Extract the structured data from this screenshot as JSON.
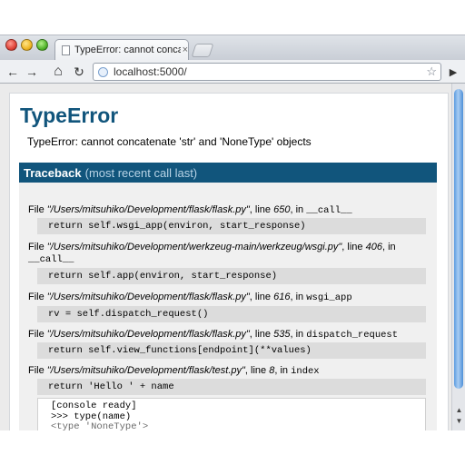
{
  "tab": {
    "title": "TypeError: cannot concatenate",
    "close": "×"
  },
  "toolbar": {
    "back_icon": "←",
    "forward_icon": "→",
    "home_icon": "⌂",
    "reload_icon": "↻",
    "url": "localhost:5000/",
    "star_icon": "☆",
    "page_menu_icon": "▶"
  },
  "error": {
    "title": "TypeError",
    "message": "TypeError: cannot concatenate 'str' and 'NoneType' objects"
  },
  "traceback": {
    "header": "Traceback",
    "header_sub": "(most recent call last)",
    "frames": [
      {
        "file": "\"/Users/mitsuhiko/Development/flask/flask.py\"",
        "line": "650",
        "func": "__call__",
        "code": "return self.wsgi_app(environ, start_response)"
      },
      {
        "file": "\"/Users/mitsuhiko/Development/werkzeug-main/werkzeug/wsgi.py\"",
        "line": "406",
        "func": "__call__",
        "code": "return self.app(environ, start_response)"
      },
      {
        "file": "\"/Users/mitsuhiko/Development/flask/flask.py\"",
        "line": "616",
        "func": "wsgi_app",
        "code": "rv = self.dispatch_request()"
      },
      {
        "file": "\"/Users/mitsuhiko/Development/flask/flask.py\"",
        "line": "535",
        "func": "dispatch_request",
        "code": "return self.view_functions[endpoint](**values)"
      },
      {
        "file": "\"/Users/mitsuhiko/Development/flask/test.py\"",
        "line": "8",
        "func": "index",
        "code": "return 'Hello ' + name"
      }
    ],
    "labels": {
      "file": "File",
      "line": ", line",
      "in": ", in"
    }
  },
  "console": {
    "ready": "[console ready]",
    "cmd": ">>> type(name)",
    "result": "<type 'NoneType'>",
    "prompt": ">>>"
  }
}
